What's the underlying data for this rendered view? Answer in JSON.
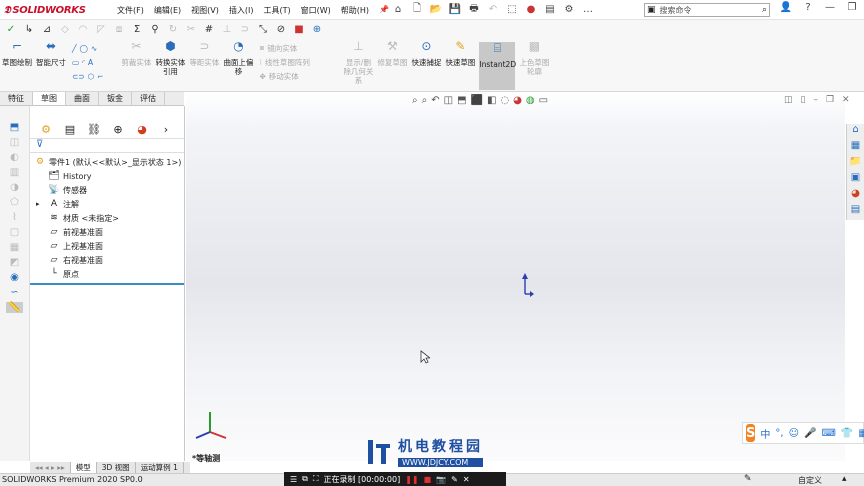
{
  "app": {
    "brand": "SOLIDWORKS"
  },
  "menu": [
    "文件(F)",
    "编辑(E)",
    "视图(V)",
    "插入(I)",
    "工具(T)",
    "窗口(W)",
    "帮助(H)"
  ],
  "search": {
    "placeholder": "搜索命令"
  },
  "command_manager": {
    "buttons": [
      {
        "label": "草图绘制",
        "enabled": true
      },
      {
        "label": "智能尺寸",
        "enabled": true
      },
      {
        "label": "剪裁实体",
        "enabled": false
      },
      {
        "label": "转换实体引用",
        "enabled": true
      },
      {
        "label": "等距实体",
        "enabled": false
      },
      {
        "label": "曲面上偏移",
        "enabled": true
      },
      {
        "label": "显示/删除几何关系",
        "enabled": false
      },
      {
        "label": "修复草图",
        "enabled": false
      },
      {
        "label": "快速捕捉",
        "enabled": true
      },
      {
        "label": "快速草图",
        "enabled": true
      },
      {
        "label": "Instant2D",
        "enabled": true
      },
      {
        "label": "上色草图轮廓",
        "enabled": false
      }
    ],
    "small_items": [
      "镜向实体",
      "线性草图阵列",
      "移动实体"
    ]
  },
  "tabs": [
    {
      "label": "特征",
      "active": false
    },
    {
      "label": "草图",
      "active": true
    },
    {
      "label": "曲面",
      "active": false
    },
    {
      "label": "钣金",
      "active": false
    },
    {
      "label": "评估",
      "active": false
    }
  ],
  "tree": {
    "root": "零件1 (默认<<默认>_显示状态 1>)",
    "nodes": [
      "History",
      "传感器",
      "注解",
      "材质 <未指定>",
      "前视基准面",
      "上视基准面",
      "右视基准面",
      "原点"
    ]
  },
  "view": {
    "orientation_label": "*等轴测"
  },
  "bottom_tabs": [
    {
      "label": "模型",
      "active": true
    },
    {
      "label": "3D 视图",
      "active": false
    },
    {
      "label": "运动算例 1",
      "active": false
    }
  ],
  "status": {
    "left": "SOLIDWORKS Premium 2020 SP0.0",
    "right": "自定义"
  },
  "recording": {
    "text": "正在录制 [00:00:00]"
  },
  "watermark": {
    "title": "机电教程园",
    "url": "WWW.JDJCY.COM"
  },
  "ime": {
    "lang": "中"
  },
  "colors": {
    "brand_red": "#c8102e",
    "accent_blue": "#1e4fa0",
    "origin_blue": "#2a3fb0",
    "ime_orange": "#f58220"
  }
}
